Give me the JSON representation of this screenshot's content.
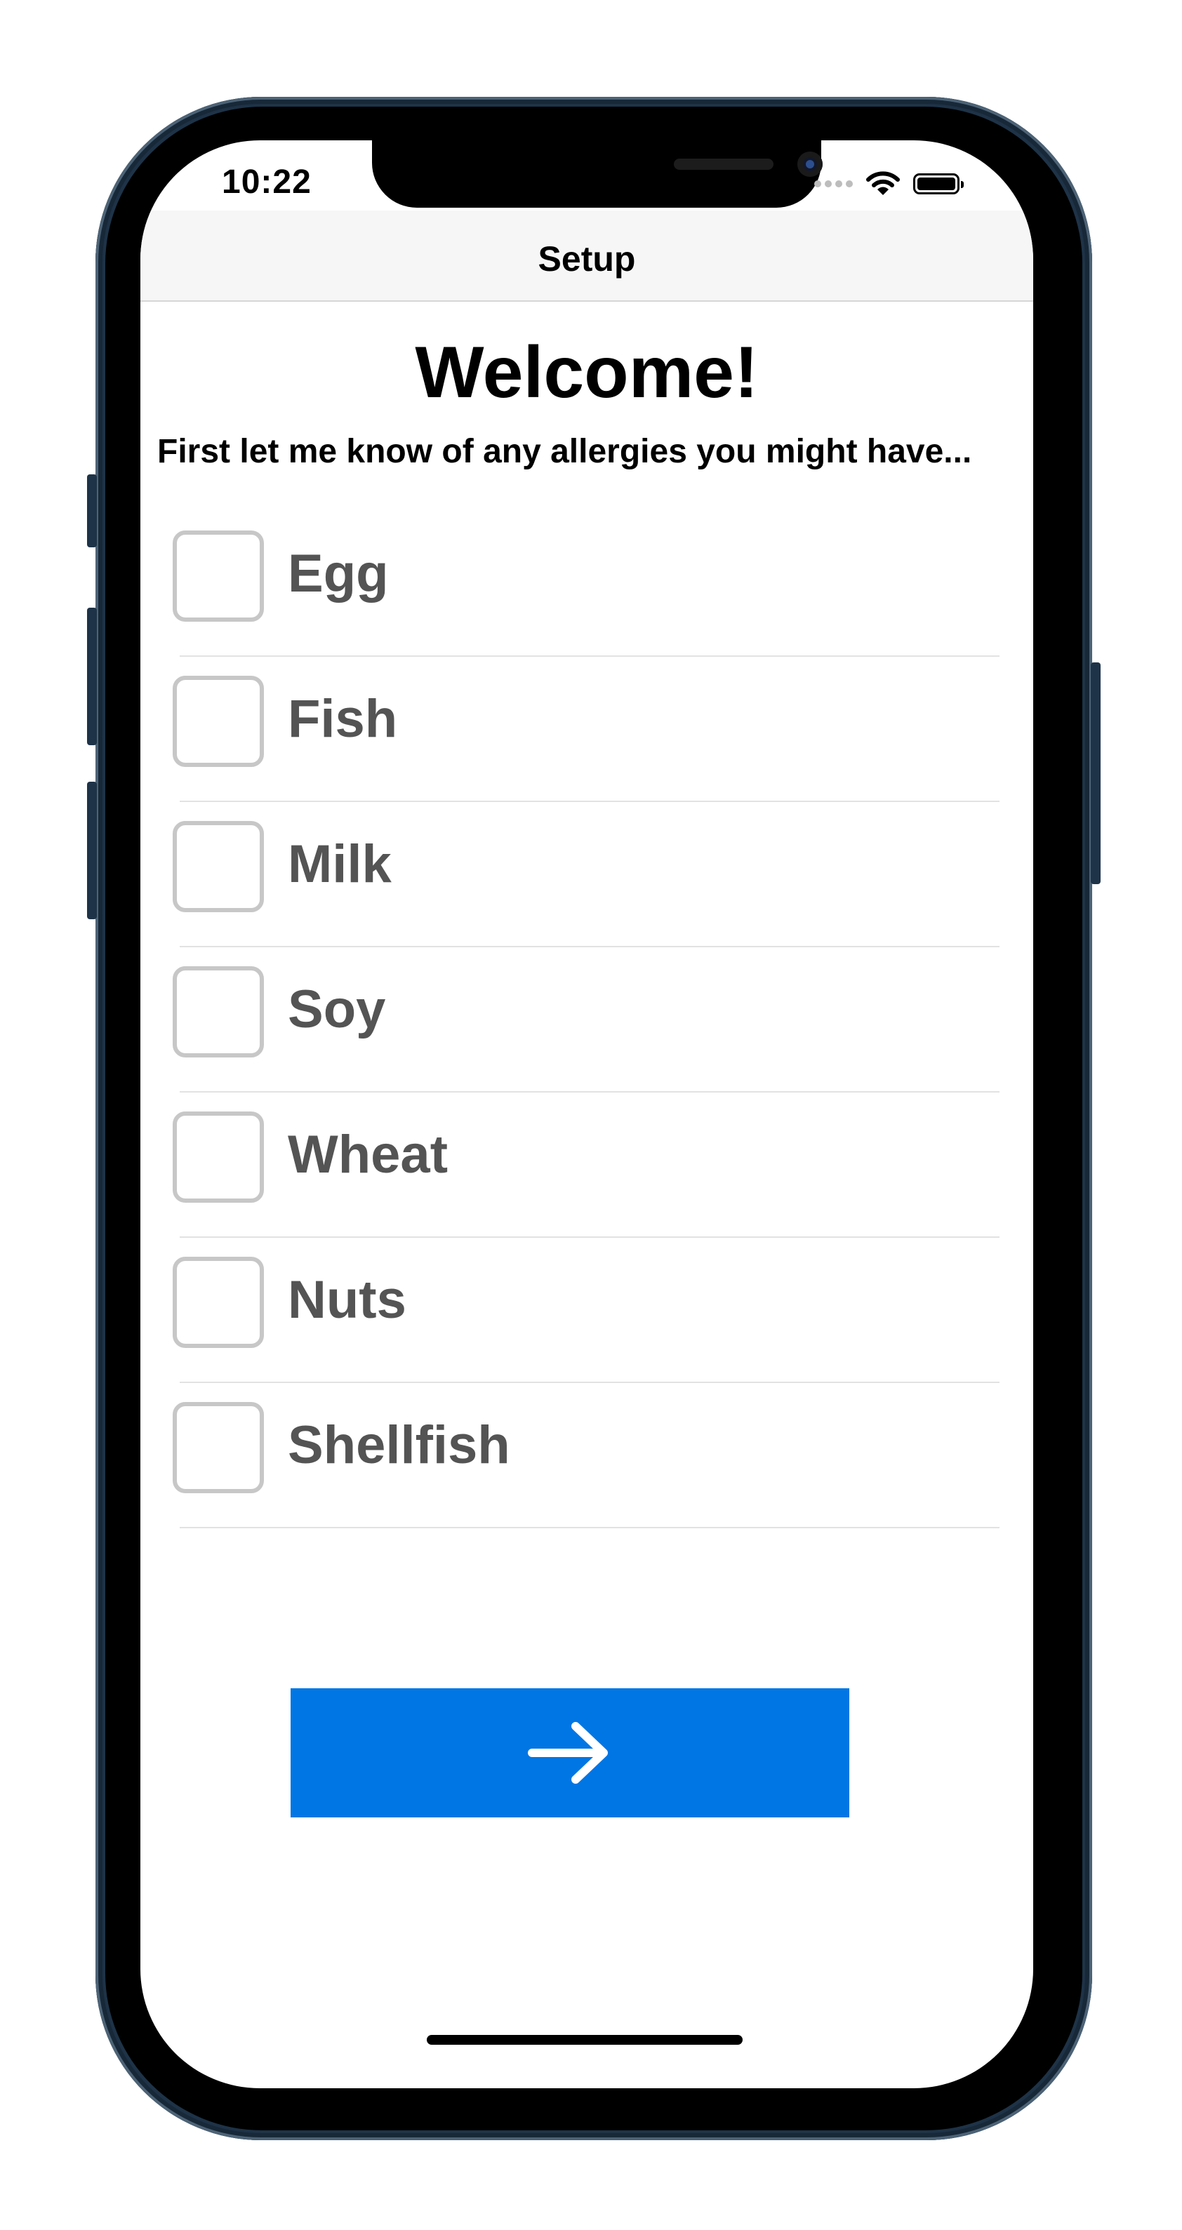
{
  "status_bar": {
    "time": "10:22",
    "icons": [
      "signal-dots-icon",
      "wifi-icon",
      "battery-icon"
    ]
  },
  "nav": {
    "title": "Setup"
  },
  "content": {
    "heading": "Welcome!",
    "subtitle": "First let me know of any allergies you might have...",
    "allergies": [
      {
        "label": "Egg",
        "checked": false
      },
      {
        "label": "Fish",
        "checked": false
      },
      {
        "label": "Milk",
        "checked": false
      },
      {
        "label": "Soy",
        "checked": false
      },
      {
        "label": "Wheat",
        "checked": false
      },
      {
        "label": "Nuts",
        "checked": false
      },
      {
        "label": "Shellfish",
        "checked": false
      }
    ]
  },
  "next_button": {
    "icon": "arrow-right-icon"
  },
  "colors": {
    "accent": "#0076e4",
    "label_text": "#545454",
    "checkbox_border": "#c7c7c7",
    "navbar_bg": "#f6f6f6",
    "phone_frame": "#1e3347"
  }
}
